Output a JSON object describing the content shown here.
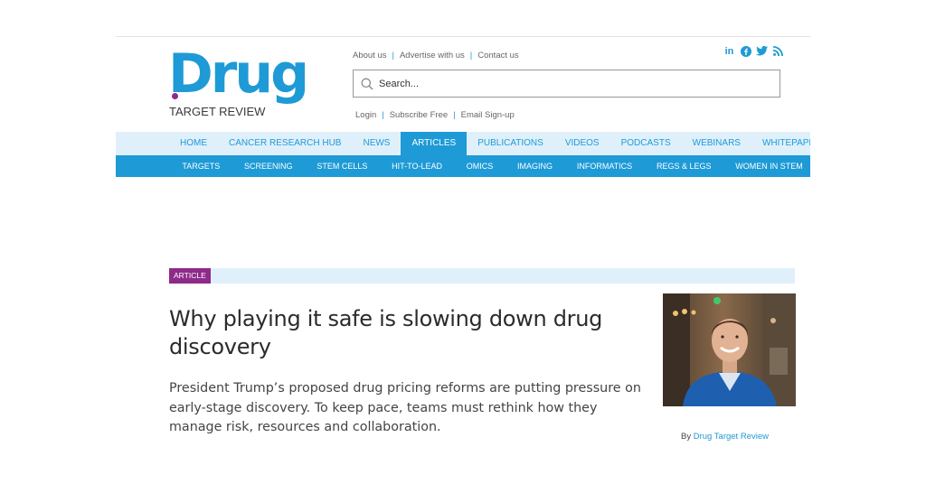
{
  "logo": {
    "word": "Drug",
    "sub": "TARGET REVIEW"
  },
  "top_links": {
    "about": "About us",
    "advertise": "Advertise with us",
    "contact": "Contact us"
  },
  "login_links": {
    "login": "Login",
    "subscribe": "Subscribe Free",
    "signup": "Email Sign-up"
  },
  "social": {
    "linkedin": "in"
  },
  "search": {
    "placeholder": "Search..."
  },
  "nav_primary": [
    "HOME",
    "CANCER RESEARCH HUB",
    "NEWS",
    "ARTICLES",
    "PUBLICATIONS",
    "VIDEOS",
    "PODCASTS",
    "WEBINARS",
    "WHITEPAPERS / APP NO"
  ],
  "nav_primary_active": "ARTICLES",
  "nav_secondary": [
    "TARGETS",
    "SCREENING",
    "STEM CELLS",
    "HIT-TO-LEAD",
    "OMICS",
    "IMAGING",
    "INFORMATICS",
    "REGS & LEGS",
    "WOMEN IN STEM"
  ],
  "article": {
    "tag": "ARTICLE",
    "headline": "Why playing it safe is slowing down drug discovery",
    "standfirst": "President Trump’s proposed drug pricing reforms are putting pressure on early-stage discovery. To keep pace, teams must rethink how they manage risk, resources and collaboration.",
    "byline_prefix": "By",
    "author": "Drug Target Review"
  },
  "colors": {
    "brand_blue": "#1e9ad6",
    "light_blue": "#dff0fa",
    "article_tag": "#8e2a8b"
  }
}
